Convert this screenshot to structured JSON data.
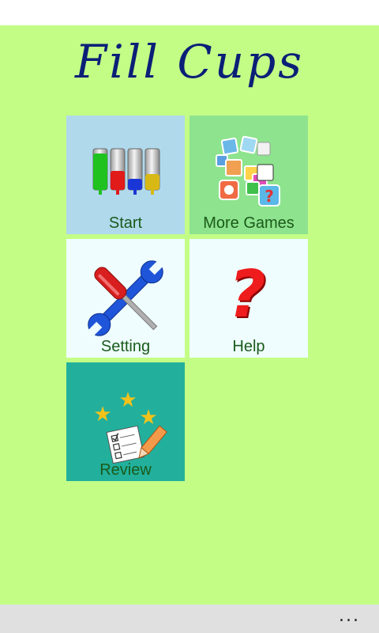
{
  "app": {
    "title": "Fill Cups"
  },
  "menu": {
    "start": {
      "label": "Start",
      "icon": "colored-cups-icon"
    },
    "more_games": {
      "label": "More Games",
      "icon": "game-collection-icon"
    },
    "setting": {
      "label": "Setting",
      "icon": "wrench-screwdriver-icon"
    },
    "help": {
      "label": "Help",
      "icon": "question-mark-icon"
    },
    "review": {
      "label": "Review",
      "icon": "stars-checklist-icon"
    }
  },
  "appbar": {
    "more_label": "..."
  },
  "colors": {
    "background": "#c3fd86",
    "title": "#0b1f77",
    "tile_start": "#b0d9ec",
    "tile_more_games": "#8ee38e",
    "tile_setting": "#effdff",
    "tile_help": "#effdff",
    "tile_review": "#22b09c"
  }
}
